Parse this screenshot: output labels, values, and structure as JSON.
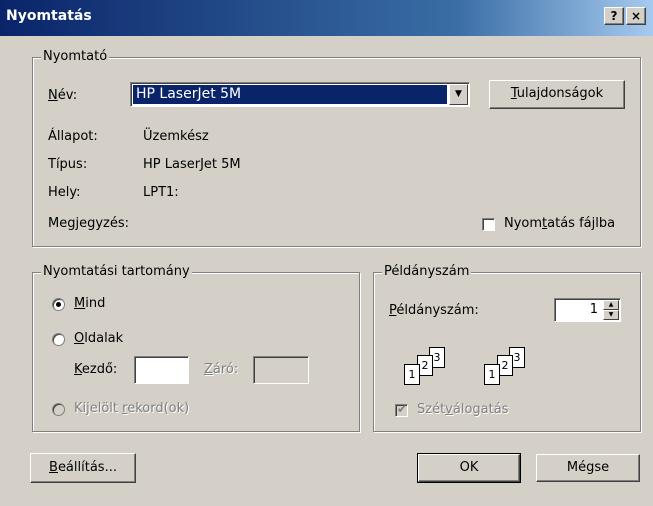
{
  "window": {
    "title": "Nyomtatás",
    "help_label": "?",
    "close_label": "×"
  },
  "printer": {
    "group_label": "Nyomtató",
    "name_label": "Név:",
    "name_value": "HP LaserJet 5M",
    "properties_button": "Tulajdonságok",
    "status_label": "Állapot:",
    "status_value": "Üzemkész",
    "type_label": "Típus:",
    "type_value": "HP LaserJet 5M",
    "where_label": "Hely:",
    "where_value": "LPT1:",
    "comment_label": "Megjegyzés:",
    "print_to_file_label": "Nyomtatás fájlba",
    "print_to_file_checked": false
  },
  "print_range": {
    "group_label": "Nyomtatási tartomány",
    "all_label": "Mind",
    "pages_label": "Oldalak",
    "from_label": "Kezdő:",
    "from_value": "",
    "to_label": "Záró:",
    "to_value": "",
    "selection_label": "Kijelölt rekord(ok)",
    "selected_option": "all"
  },
  "copies": {
    "group_label": "Példányszám",
    "count_label": "Példányszám:",
    "count_value": "1",
    "collate_label": "Szétválogatás",
    "collate_checked": true,
    "collate_disabled": true,
    "page_numbers": [
      "1",
      "2",
      "3"
    ]
  },
  "footer": {
    "setup_button": "Beállítás...",
    "ok_button": "OK",
    "cancel_button": "Mégse"
  },
  "colors": {
    "titlebar": "#0a246a",
    "face": "#d4d0c8",
    "selection": "#0a246a"
  }
}
